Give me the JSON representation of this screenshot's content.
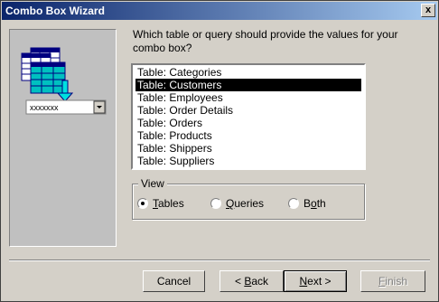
{
  "window": {
    "title": "Combo Box Wizard",
    "close_glyph": "x"
  },
  "illustration": {
    "combo_text": "xxxxxxx"
  },
  "prompt": "Which table or query should provide the values for your combo box?",
  "list": {
    "items": [
      "Table: Categories",
      "Table: Customers",
      "Table: Employees",
      "Table: Order Details",
      "Table: Orders",
      "Table: Products",
      "Table: Shippers",
      "Table: Suppliers"
    ],
    "selected_index": 1
  },
  "view": {
    "label": "View",
    "options": [
      {
        "pre": "",
        "ul": "T",
        "post": "ables",
        "checked": true
      },
      {
        "pre": "",
        "ul": "Q",
        "post": "ueries",
        "checked": false
      },
      {
        "pre": "B",
        "ul": "o",
        "post": "th",
        "checked": false
      }
    ]
  },
  "buttons": {
    "cancel": "Cancel",
    "back": {
      "pre": "< ",
      "ul": "B",
      "post": "ack"
    },
    "next": {
      "pre": "",
      "ul": "N",
      "post": "ext >"
    },
    "finish": {
      "pre": "",
      "ul": "F",
      "post": "inish"
    }
  },
  "colors": {
    "title_start": "#0a246a",
    "title_end": "#a6caf0",
    "face": "#d4d0c8",
    "teal": "#00c0c0"
  }
}
